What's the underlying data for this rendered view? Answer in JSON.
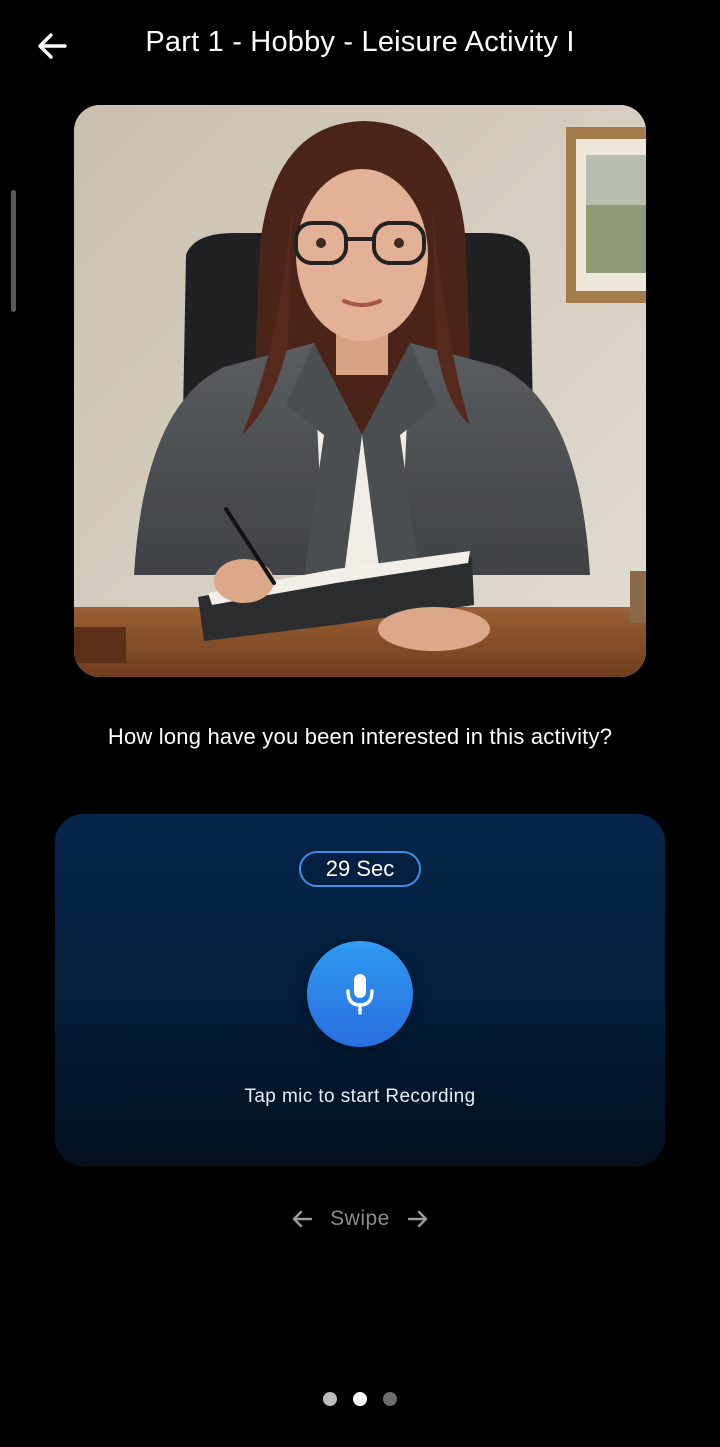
{
  "header": {
    "back_icon": "arrow-left-icon",
    "title": "Part 1 - Hobby - Leisure Activity I"
  },
  "question": {
    "text": "How long have you been interested in this activity?"
  },
  "recorder": {
    "timer": "29 Sec",
    "mic_icon": "microphone-icon",
    "hint": "Tap mic to start Recording",
    "accent_color": "#3d8fe8",
    "mic_color": "#2f86ee"
  },
  "swipe": {
    "label": "Swipe",
    "left_icon": "arrow-left-icon",
    "right_icon": "arrow-right-icon"
  },
  "pagination": {
    "total": 3,
    "active_index": 1
  }
}
